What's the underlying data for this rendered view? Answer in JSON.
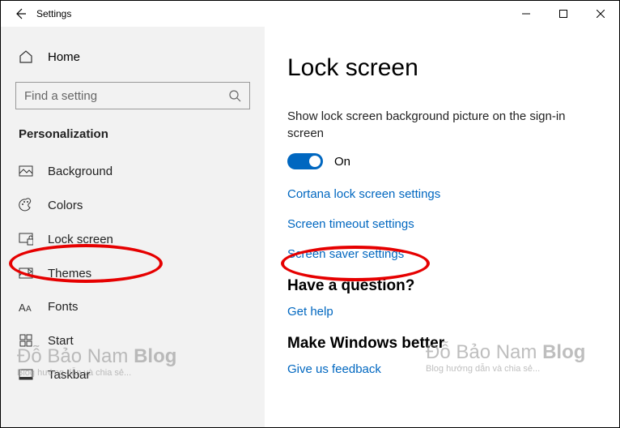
{
  "titlebar": {
    "title": "Settings"
  },
  "sidebar": {
    "home": "Home",
    "search_placeholder": "Find a setting",
    "section": "Personalization",
    "items": [
      {
        "label": "Background"
      },
      {
        "label": "Colors"
      },
      {
        "label": "Lock screen"
      },
      {
        "label": "Themes"
      },
      {
        "label": "Fonts"
      },
      {
        "label": "Start"
      },
      {
        "label": "Taskbar"
      }
    ]
  },
  "main": {
    "title": "Lock screen",
    "description": "Show lock screen background picture on the sign-in screen",
    "toggle_state": "On",
    "links": [
      "Cortana lock screen settings",
      "Screen timeout settings",
      "Screen saver settings"
    ],
    "question_heading": "Have a question?",
    "get_help": "Get help",
    "better_heading": "Make Windows better",
    "feedback": "Give us feedback"
  },
  "watermark": {
    "line1_a": "Đỗ Bảo Nam ",
    "line1_b": "Blog",
    "line2": "Blog hướng dẫn và chia sẻ..."
  }
}
